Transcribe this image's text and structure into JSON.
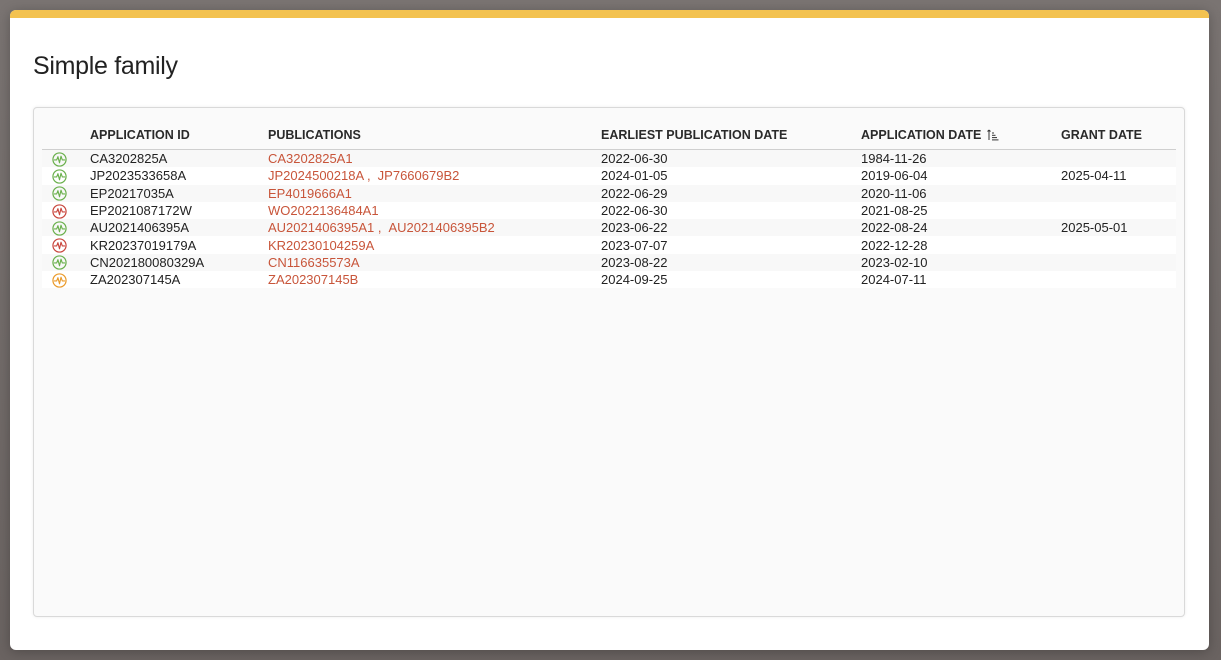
{
  "modal": {
    "title": "Simple family",
    "accent_color": "#f3c250"
  },
  "table": {
    "columns": {
      "application_id": "APPLICATION ID",
      "publications": "PUBLICATIONS",
      "earliest_publication_date": "EARLIEST PUBLICATION DATE",
      "application_date": "APPLICATION DATE",
      "grant_date": "GRANT DATE"
    },
    "sort_icon": "sort-ascending-icon",
    "status_colors": {
      "green": "#6ab04c",
      "red": "#c9463d",
      "orange": "#ea9a2a"
    },
    "link_color": "#c8553a",
    "rows": [
      {
        "status": "green",
        "application_id": "CA3202825A",
        "publications": [
          "CA3202825A1"
        ],
        "earliest": "2022-06-30",
        "app_date": "1984-11-26",
        "grant_date": ""
      },
      {
        "status": "green",
        "application_id": "JP2023533658A",
        "publications": [
          "JP2024500218A",
          "JP7660679B2"
        ],
        "earliest": "2024-01-05",
        "app_date": "2019-06-04",
        "grant_date": "2025-04-11"
      },
      {
        "status": "green",
        "application_id": "EP20217035A",
        "publications": [
          "EP4019666A1"
        ],
        "earliest": "2022-06-29",
        "app_date": "2020-11-06",
        "grant_date": ""
      },
      {
        "status": "red",
        "application_id": "EP2021087172W",
        "publications": [
          "WO2022136484A1"
        ],
        "earliest": "2022-06-30",
        "app_date": "2021-08-25",
        "grant_date": ""
      },
      {
        "status": "green",
        "application_id": "AU2021406395A",
        "publications": [
          "AU2021406395A1",
          "AU2021406395B2"
        ],
        "earliest": "2023-06-22",
        "app_date": "2022-08-24",
        "grant_date": "2025-05-01"
      },
      {
        "status": "red",
        "application_id": "KR20237019179A",
        "publications": [
          "KR20230104259A"
        ],
        "earliest": "2023-07-07",
        "app_date": "2022-12-28",
        "grant_date": ""
      },
      {
        "status": "green",
        "application_id": "CN202180080329A",
        "publications": [
          "CN116635573A"
        ],
        "earliest": "2023-08-22",
        "app_date": "2023-02-10",
        "grant_date": ""
      },
      {
        "status": "orange",
        "application_id": "ZA202307145A",
        "publications": [
          "ZA202307145B"
        ],
        "earliest": "2024-09-25",
        "app_date": "2024-07-11",
        "grant_date": ""
      }
    ]
  }
}
